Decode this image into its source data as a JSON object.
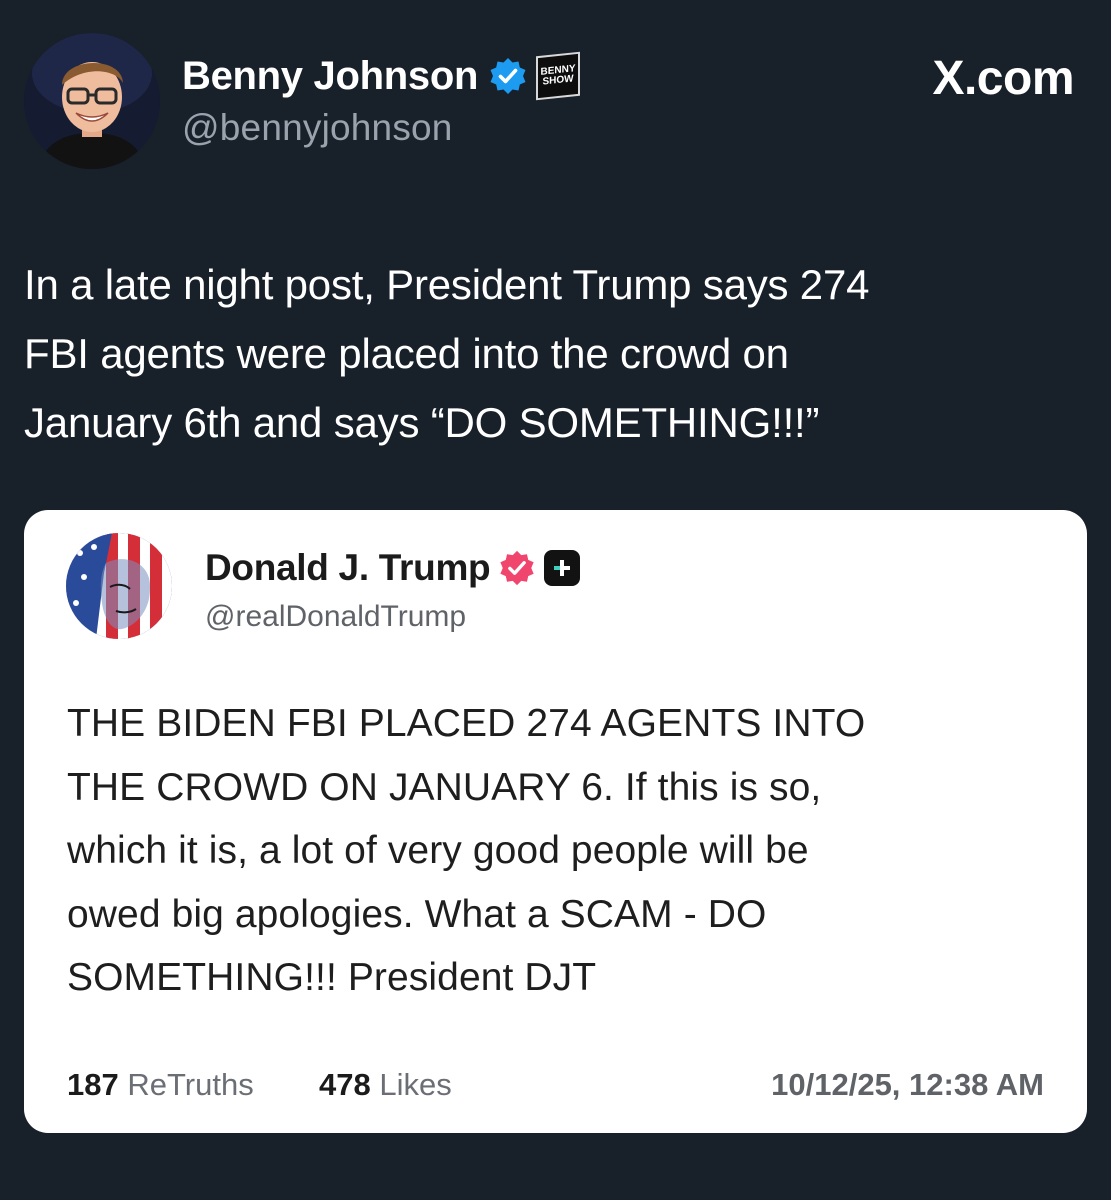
{
  "post": {
    "author_name": "Benny Johnson",
    "author_handle": "@bennyjohnson",
    "show_logo_lines": [
      "BENNY",
      "SHOW"
    ],
    "site_label": "X.com",
    "text_lines": [
      "In a late night post, President Trump says 274",
      "FBI agents were placed into the crowd on",
      "January 6th and says “DO SOMETHING!!!”"
    ],
    "verified_color": "#1d9bf0"
  },
  "truth": {
    "author_name": "Donald J. Trump",
    "author_handle": "@realDonaldTrump",
    "verified_color": "#f0466e",
    "body_lines": [
      "THE BIDEN FBI PLACED 274 AGENTS INTO",
      "THE CROWD ON JANUARY 6. If this is so,",
      "which it is, a lot of very good people will be",
      "owed big apologies. What a SCAM - DO",
      "SOMETHING!!! President DJT"
    ],
    "retruths_count": "187",
    "retruths_label": "ReTruths",
    "likes_count": "478",
    "likes_label": "Likes",
    "timestamp": "10/12/25, 12:38 AM"
  }
}
